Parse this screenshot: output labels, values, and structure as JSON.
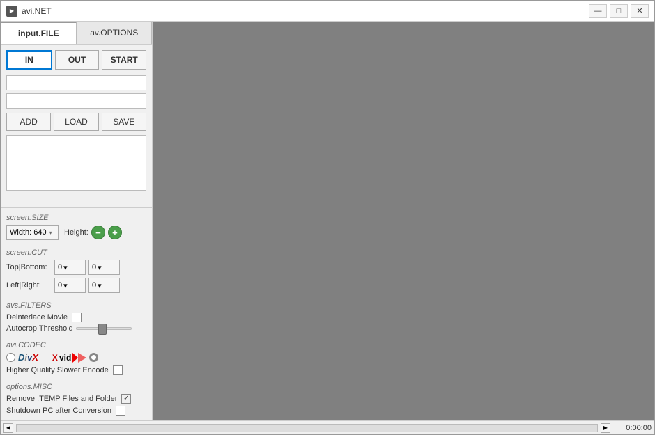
{
  "window": {
    "title": "avi.NET",
    "controls": {
      "minimize": "—",
      "maximize": "□",
      "close": "✕"
    }
  },
  "tabs": [
    {
      "id": "input-file",
      "label": "input.FILE",
      "active": true
    },
    {
      "id": "av-options",
      "label": "av.OPTIONS",
      "active": false
    }
  ],
  "io_buttons": [
    {
      "id": "in",
      "label": "IN",
      "active": true
    },
    {
      "id": "out",
      "label": "OUT",
      "active": false
    },
    {
      "id": "start",
      "label": "START",
      "active": false
    }
  ],
  "file_buttons": [
    {
      "id": "add",
      "label": "ADD"
    },
    {
      "id": "load",
      "label": "LOAD"
    },
    {
      "id": "save",
      "label": "SAVE"
    }
  ],
  "screen_size": {
    "title": "screen.SIZE",
    "width_label": "Width: 640",
    "height_label": "Height:",
    "decrease": "−",
    "increase": "+"
  },
  "screen_cut": {
    "title": "screen.CUT",
    "top_bottom_label": "Top|Bottom:",
    "left_right_label": "Left|Right:",
    "values": [
      "0",
      "0"
    ],
    "dropdown_arrow": "▾"
  },
  "avs_filters": {
    "title": "avs.FILTERS",
    "deinterlace_label": "Deinterlace Movie",
    "autocrop_label": "Autocrop Threshold"
  },
  "avi_codec": {
    "title": "avi.CODEC",
    "divx_label": "DivX",
    "xvid_label": "Xvid",
    "higher_quality_label": "Higher Quality Slower Encode",
    "xvid_selected": true
  },
  "options_misc": {
    "title": "options.MISC",
    "remove_temp_label": "Remove .TEMP Files and Folder",
    "shutdown_label": "Shutdown PC after Conversion",
    "remove_temp_checked": true,
    "shutdown_checked": false
  },
  "status": {
    "time": "0:00:00"
  }
}
